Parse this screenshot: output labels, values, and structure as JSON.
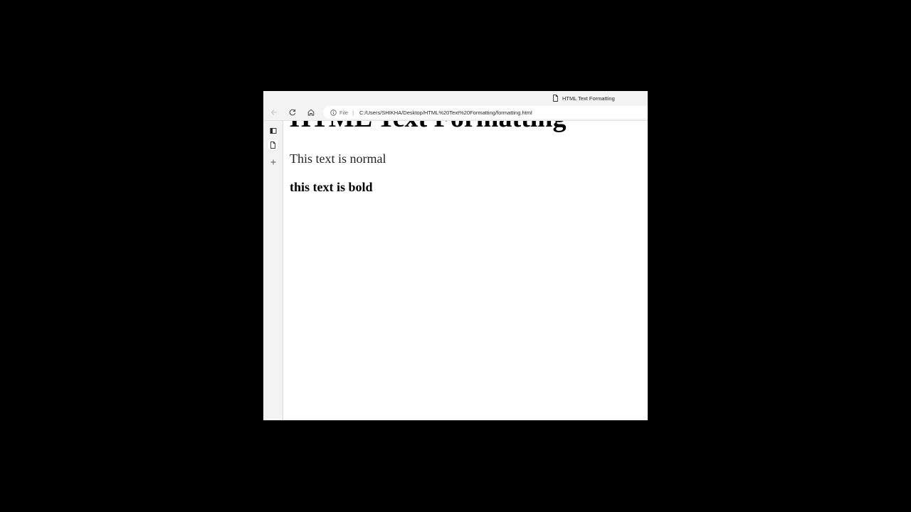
{
  "tab": {
    "title": "HTML Text Formatting"
  },
  "toolbar": {
    "back_icon": "arrow-left-icon",
    "reload_icon": "reload-icon",
    "home_icon": "home-icon",
    "info_icon": "info-icon",
    "file_label": "File",
    "separator": "|",
    "url": "C:/Users/SHIKHA/Desktop/HTML%20Text%20Formatting/formatting.html"
  },
  "sidebar": {
    "items": [
      {
        "icon": "tab-actions-icon"
      },
      {
        "icon": "page-icon"
      },
      {
        "icon": "plus-icon"
      }
    ]
  },
  "page": {
    "heading": "HTML Text Formatting",
    "normal_text": "This text is normal",
    "bold_text": "this text is bold"
  },
  "colors": {
    "background": "#000000",
    "chrome": "#f3f3f3",
    "content": "#ffffff"
  }
}
